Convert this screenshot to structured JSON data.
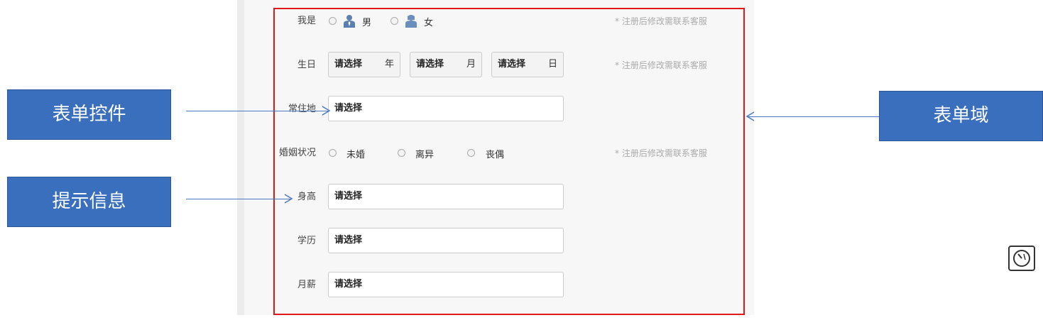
{
  "form": {
    "gender": {
      "label": "我是",
      "options": [
        {
          "label": "男"
        },
        {
          "label": "女"
        }
      ],
      "hint": "* 注册后修改需联系客服"
    },
    "birthday": {
      "label": "生日",
      "selects": [
        {
          "value": "请选择",
          "unit": "年"
        },
        {
          "value": "请选择",
          "unit": "月"
        },
        {
          "value": "请选择",
          "unit": "日"
        }
      ],
      "hint": "* 注册后修改需联系客服"
    },
    "residence": {
      "label": "常住地",
      "value": "请选择"
    },
    "marital": {
      "label": "婚姻状况",
      "options": [
        {
          "label": "未婚"
        },
        {
          "label": "离异"
        },
        {
          "label": "丧偶"
        }
      ],
      "hint": "* 注册后修改需联系客服"
    },
    "height": {
      "label": "身高",
      "value": "请选择"
    },
    "education": {
      "label": "学历",
      "value": "请选择"
    },
    "salary": {
      "label": "月薪",
      "value": "请选择"
    }
  },
  "callouts": {
    "form_control": "表单控件",
    "prompt_info": "提示信息",
    "form_field": "表单域"
  },
  "colors": {
    "callout_bg": "#3a6fbd",
    "frame": "#e01818",
    "male_icon": "#5b7fae",
    "female_icon": "#6b8fbc"
  },
  "icons": [
    "male-icon",
    "female-icon",
    "speed-badge-icon"
  ]
}
